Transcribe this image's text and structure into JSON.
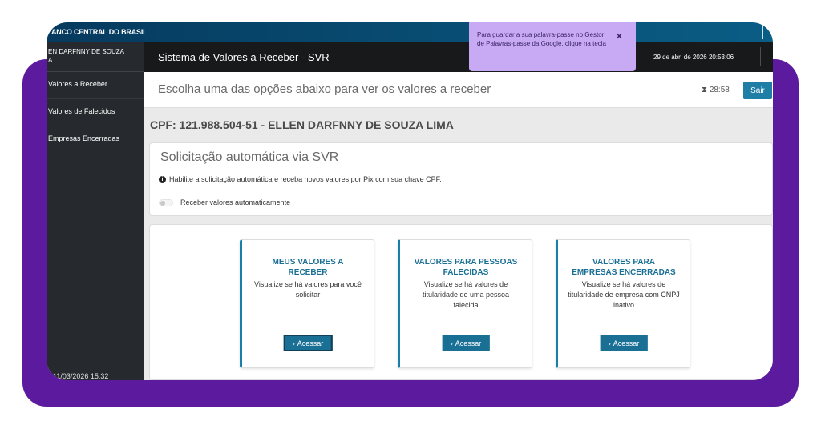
{
  "top_bar": {
    "bank_name": "ANCO CENTRAL DO BRASIL"
  },
  "sidebar": {
    "user_line1": "EN DARFNNY DE SOUZA",
    "user_line2": "A",
    "items": [
      {
        "label": "Valores a Receber"
      },
      {
        "label": "Valores de Falecidos"
      },
      {
        "label": "Empresas Encerradas"
      }
    ],
    "footer_date": "11/03/2026 15:32"
  },
  "header": {
    "system_name": "Sistema de Valores a Receber - SVR",
    "datetime": "29 de abr. de 2026 20:53:06"
  },
  "toast": {
    "message": "Para guardar a sua palavra-passe no Gestor de Palavras-passe da Google, clique na tecla",
    "close_glyph": "✕"
  },
  "choose_bar": {
    "title": "Escolha uma das opções abaixo para ver os valores a receber",
    "timer": "28:58",
    "timer_icon": "⧗",
    "logout_label": "Sair"
  },
  "cpf_line": "CPF: 121.988.504-51 - ELLEN DARFNNY DE SOUZA LIMA",
  "auto_request": {
    "title": "Solicitação automática via SVR",
    "info_text": "Habilite a solicitação automática e receba novos valores por Pix com sua chave CPF.",
    "toggle_label": "Receber valores automaticamente",
    "toggle_on": false
  },
  "cards": [
    {
      "title": "MEUS VALORES A RECEBER",
      "description": "Visualize se há valores para você solicitar",
      "button": "Acessar"
    },
    {
      "title": "VALORES PARA PESSOAS FALECIDAS",
      "description": "Visualize se há valores de titularidade de uma pessoa falecida",
      "button": "Acessar"
    },
    {
      "title": "VALORES PARA EMPRESAS ENCERRADAS",
      "description": "Visualize se há valores de titularidade de empresa com CNPJ inativo",
      "button": "Acessar"
    }
  ],
  "colors": {
    "purple_frame": "#5c1a9e",
    "primary_blue": "#1a6f95",
    "sidebar": "#262a2e",
    "toast": "#c8aaf4"
  }
}
